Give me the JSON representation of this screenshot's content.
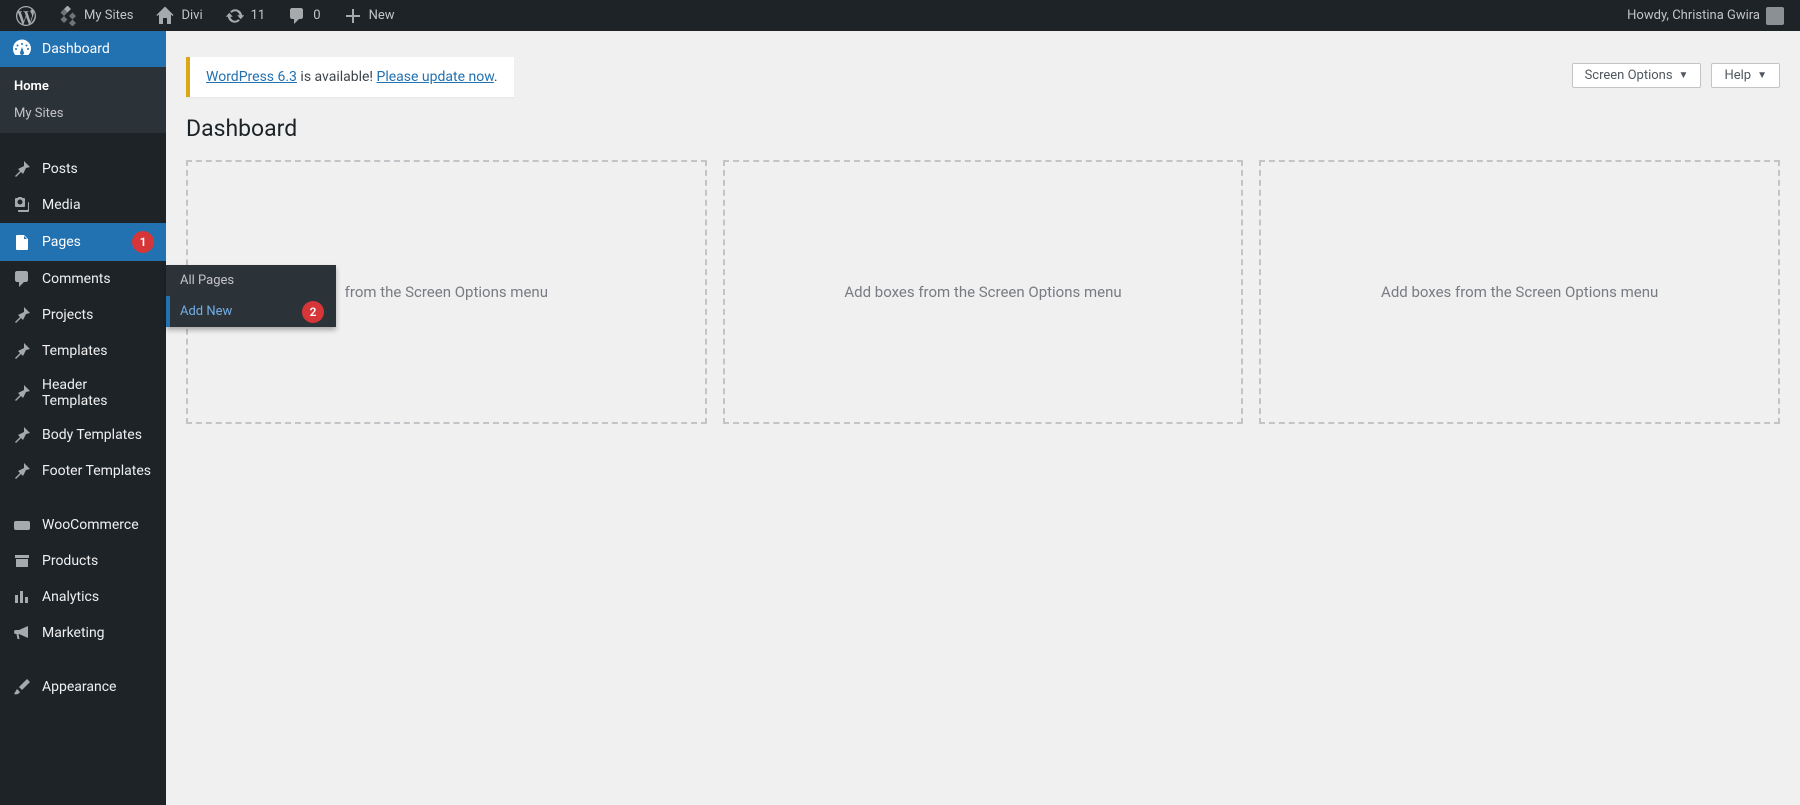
{
  "toolbar": {
    "my_sites": "My Sites",
    "site_name": "Divi",
    "updates_count": "11",
    "comments_count": "0",
    "new_label": "New",
    "howdy": "Howdy, Christina Gwira"
  },
  "adminmenu": {
    "dashboard": "Dashboard",
    "dashboard_sub": {
      "home": "Home",
      "my_sites": "My Sites"
    },
    "posts": "Posts",
    "media": "Media",
    "pages": "Pages",
    "pages_badge": "1",
    "comments": "Comments",
    "projects": "Projects",
    "templates": "Templates",
    "header_templates": "Header Templates",
    "body_templates": "Body Templates",
    "footer_templates": "Footer Templates",
    "woocommerce": "WooCommerce",
    "products": "Products",
    "analytics": "Analytics",
    "marketing": "Marketing",
    "appearance": "Appearance"
  },
  "flyout": {
    "all_pages": "All Pages",
    "add_new": "Add New",
    "add_new_badge": "2"
  },
  "content": {
    "screen_options": "Screen Options",
    "help": "Help",
    "notice_link1": "WordPress 6.3",
    "notice_text": " is available! ",
    "notice_link2": "Please update now",
    "notice_period": ".",
    "page_title": "Dashboard",
    "box_text": "Add boxes from the Screen Options menu",
    "box_text_clipped": "from the Screen Options menu"
  }
}
